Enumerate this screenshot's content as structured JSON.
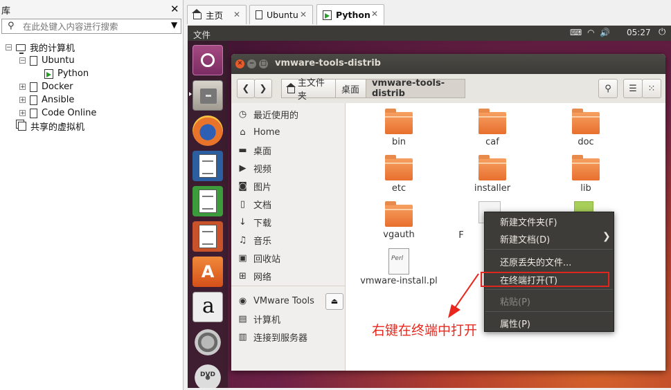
{
  "library": {
    "title": "库",
    "search_placeholder": "在此处键入内容进行搜索",
    "tree": {
      "root": "我的计算机",
      "ubuntu": "Ubuntu",
      "python": "Python",
      "docker": "Docker",
      "ansible": "Ansible",
      "code_online": "Code Online",
      "shared": "共享的虚拟机"
    }
  },
  "tabs": [
    {
      "label": "主页"
    },
    {
      "label": "Ubuntu"
    },
    {
      "label": "Python"
    }
  ],
  "vm": {
    "topbar_menu": "文件",
    "clock": "05:27",
    "window_title": "vmware-tools-distrib",
    "breadcrumbs": [
      "主文件夹",
      "桌面",
      "vmware-tools-distrib"
    ],
    "sidebar": [
      {
        "label": "最近使用的",
        "icon": "clock-icon"
      },
      {
        "label": "Home",
        "icon": "home-icon"
      },
      {
        "label": "桌面",
        "icon": "folder-icon"
      },
      {
        "label": "视频",
        "icon": "video-icon"
      },
      {
        "label": "图片",
        "icon": "camera-icon"
      },
      {
        "label": "文档",
        "icon": "document-icon"
      },
      {
        "label": "下载",
        "icon": "download-icon"
      },
      {
        "label": "音乐",
        "icon": "music-icon"
      },
      {
        "label": "回收站",
        "icon": "trash-icon"
      },
      {
        "label": "网络",
        "icon": "network-icon"
      },
      {
        "label": "VMware Tools",
        "icon": "disc-icon"
      },
      {
        "label": "计算机",
        "icon": "computer-icon"
      },
      {
        "label": "连接到服务器",
        "icon": "server-icon"
      }
    ],
    "files": [
      "bin",
      "caf",
      "doc",
      "etc",
      "installer",
      "lib",
      "vgauth",
      "F",
      "vmware-install.pl"
    ],
    "perl_label": "Perl",
    "context_menu": {
      "new_folder": "新建文件夹(F)",
      "new_document": "新建文档(D)",
      "restore": "还原丢失的文件...",
      "open_terminal": "在终端打开(T)",
      "paste": "粘贴(P)",
      "properties": "属性(P)"
    }
  },
  "annotation": "右键在终端中打开"
}
